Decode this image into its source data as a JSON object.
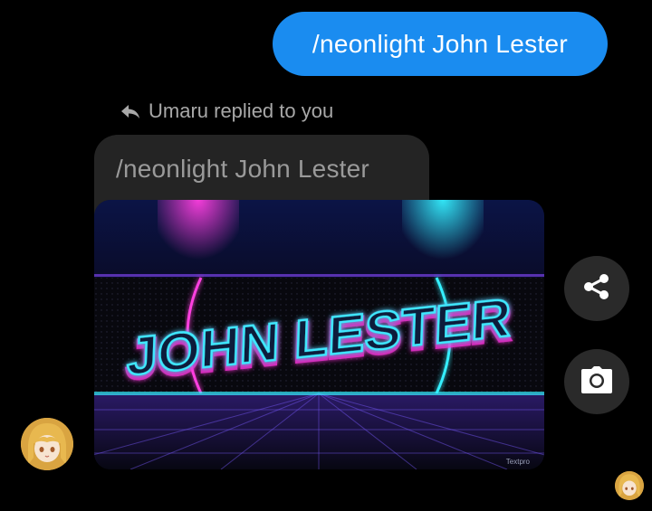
{
  "sent_message": {
    "text": "/neonlight John Lester"
  },
  "reply": {
    "label": "Umaru replied to you",
    "quoted_text": "/neonlight John Lester"
  },
  "image": {
    "neon_text": "JOHN LESTER",
    "watermark": "Textpro"
  },
  "icons": {
    "reply": "reply-arrow-icon",
    "share": "share-icon",
    "camera": "camera-icon"
  },
  "colors": {
    "sent_bubble": "#1a8cf0",
    "quoted_bubble": "#242424",
    "action_button": "#2a2a2a",
    "neon_cyan": "#3fe8ff",
    "neon_magenta": "#ff2bd6"
  }
}
